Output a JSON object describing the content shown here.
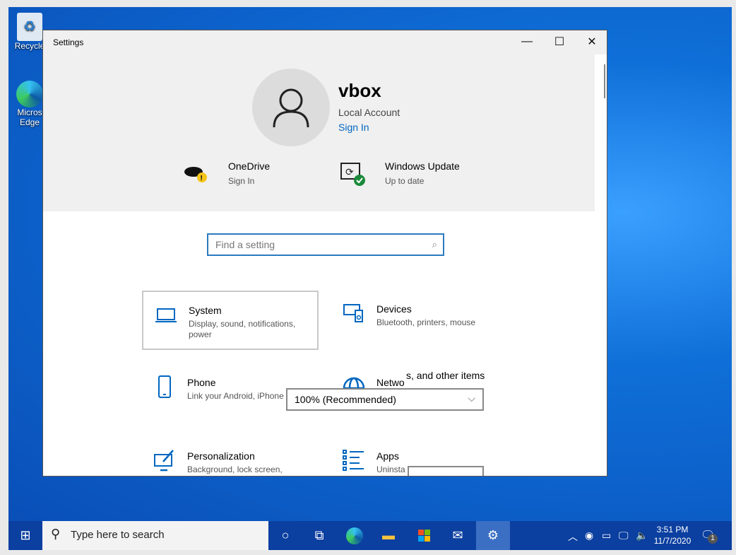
{
  "desktop": {
    "icons": [
      {
        "label": "Recycle Bin",
        "shown": "Recycle"
      },
      {
        "label": "Microsoft Edge",
        "shown": "Micros\nEdge"
      }
    ]
  },
  "window": {
    "title": "Settings",
    "minimize": "—",
    "maximize": "☐",
    "close": "✕"
  },
  "account": {
    "name": "vbox",
    "type": "Local Account",
    "sign_in": "Sign In"
  },
  "quick": [
    {
      "title": "OneDrive",
      "sub": "Sign In"
    },
    {
      "title": "Windows Update",
      "sub": "Up to date"
    }
  ],
  "search": {
    "placeholder": "Find a setting"
  },
  "tiles": [
    {
      "title": "System",
      "desc": "Display, sound, notifications, power"
    },
    {
      "title": "Devices",
      "desc": "Bluetooth, printers, mouse"
    },
    {
      "title": "Phone",
      "desc": "Link your Android, iPhone"
    },
    {
      "title": "Netwo",
      "desc": ""
    },
    {
      "title": "Personalization",
      "desc": "Background, lock screen, colors"
    },
    {
      "title": "Apps",
      "desc": "Uninsta"
    }
  ],
  "overlay": {
    "text": "s, and other items",
    "dropdown_value": "100% (Recommended)"
  },
  "taskbar": {
    "search_placeholder": "Type here to search",
    "time": "3:51 PM",
    "date": "11/7/2020",
    "notifications": "1"
  }
}
